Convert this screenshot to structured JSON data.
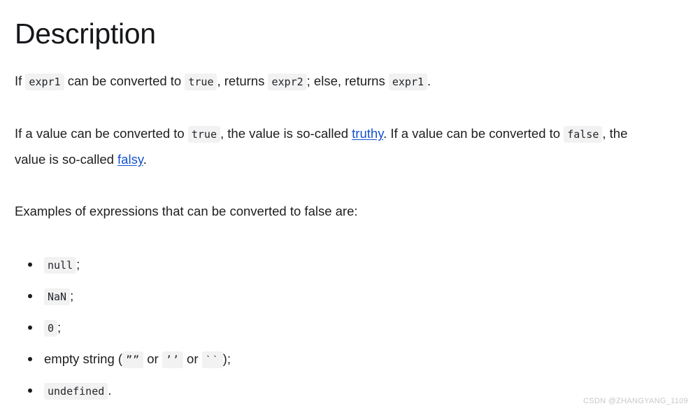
{
  "page": {
    "heading": "Description",
    "background_color": "#ffffff",
    "text_color": "#1e1e20",
    "code_bg_color": "#f2f2f2",
    "link_color": "#1452cc"
  },
  "paragraph1": {
    "t1": "If ",
    "code1": "expr1",
    "t2": " can be converted to ",
    "code2": "true",
    "t3": ", returns ",
    "code3": "expr2",
    "t4": "; else, returns ",
    "code4": "expr1",
    "t5": "."
  },
  "paragraph2": {
    "t1": "If a value can be converted to ",
    "code1": "true",
    "t2": ", the value is so-called ",
    "link1": "truthy",
    "t3": ". If a value can be converted to ",
    "code2": "false",
    "t4": ", the value is so-called ",
    "link2": "falsy",
    "t5": "."
  },
  "paragraph3": {
    "text": "Examples of expressions that can be converted to false are:"
  },
  "list": {
    "items": [
      {
        "code": "null",
        "suffix": ";"
      },
      {
        "code": "NaN",
        "suffix": ";"
      },
      {
        "code": "0",
        "suffix": ";"
      },
      {
        "prefix": "empty string (",
        "code_a": "””",
        "mid_a": " or ",
        "code_b": "’’",
        "mid_b": " or ",
        "code_c": "ˋˋ",
        "suffix": ");"
      },
      {
        "code": "undefined",
        "suffix": "."
      }
    ]
  },
  "watermark": {
    "text": "CSDN @ZHANGYANG_1109"
  }
}
